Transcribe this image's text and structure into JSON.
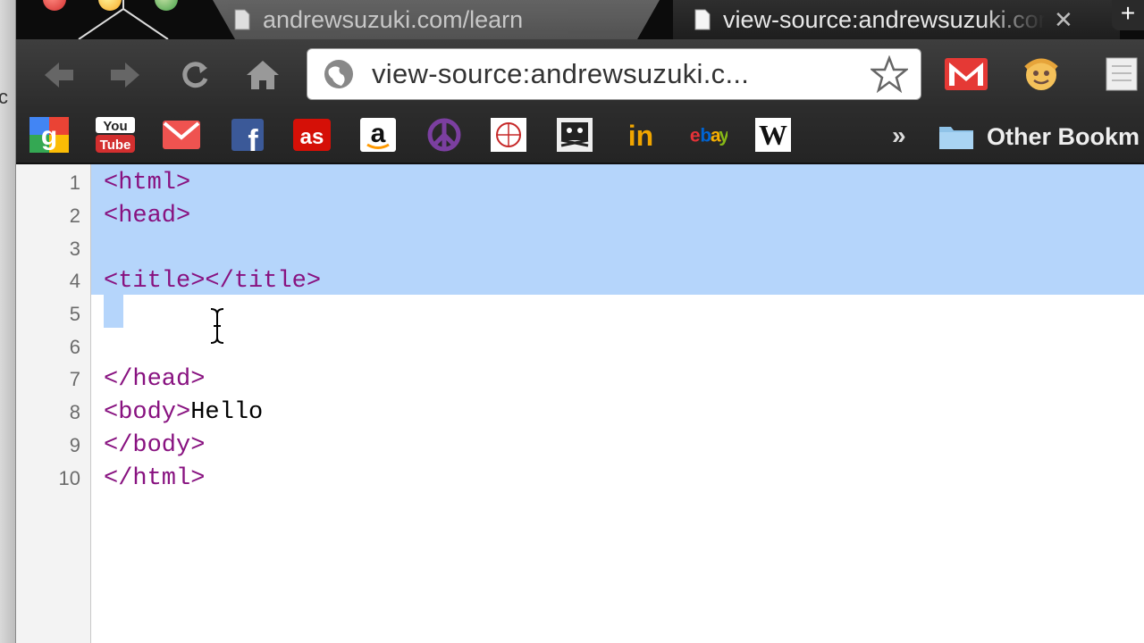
{
  "window": {
    "tabs": [
      {
        "title": "andrewsuzuki.com/learn",
        "active": false
      },
      {
        "title": "view-source:andrewsuzuki.com",
        "active": true,
        "close": "✕"
      }
    ],
    "new_tab": "+"
  },
  "toolbar": {
    "back_icon": "back-arrow-icon",
    "forward_icon": "forward-arrow-icon",
    "reload_icon": "reload-icon",
    "home_icon": "home-icon",
    "url": "view-source:andrewsuzuki.c...",
    "star_icon": "bookmark-star-icon"
  },
  "extensions": [
    {
      "name": "gmail-checker-icon"
    },
    {
      "name": "smiley-extension-icon"
    },
    {
      "name": "notes-extension-icon"
    }
  ],
  "bookmarks": {
    "items": [
      {
        "name": "google",
        "label": ""
      },
      {
        "name": "youtube",
        "label": "You Tube"
      },
      {
        "name": "gmail",
        "label": ""
      },
      {
        "name": "facebook",
        "label": "f"
      },
      {
        "name": "lastfm",
        "label": "as"
      },
      {
        "name": "amazon",
        "label": "a"
      },
      {
        "name": "peace",
        "label": "☮"
      },
      {
        "name": "bookmark-globe",
        "label": ""
      },
      {
        "name": "bookmark-pirate",
        "label": ""
      },
      {
        "name": "linkedin",
        "label": "in"
      },
      {
        "name": "ebay",
        "label": "ebY"
      },
      {
        "name": "wikipedia",
        "label": "W"
      }
    ],
    "overflow": "»",
    "folder_label": "Other Bookm"
  },
  "left_edge_fragment": "c",
  "source": {
    "lines": [
      {
        "num": "1",
        "text": "<html>"
      },
      {
        "num": "2",
        "text": "<head>"
      },
      {
        "num": "3",
        "text": ""
      },
      {
        "num": "4",
        "text": "<title></title>"
      },
      {
        "num": "5",
        "text": ""
      },
      {
        "num": "6",
        "text": ""
      },
      {
        "num": "7",
        "text": "</head>"
      },
      {
        "num": "8",
        "tag": "<body>",
        "text_after": "Hello"
      },
      {
        "num": "9",
        "text": "</body>"
      },
      {
        "num": "10",
        "text": "</html>"
      }
    ]
  },
  "colors": {
    "tag": "#881280",
    "selection": "#b5d5fb",
    "line_number": "#6b6b6b"
  }
}
